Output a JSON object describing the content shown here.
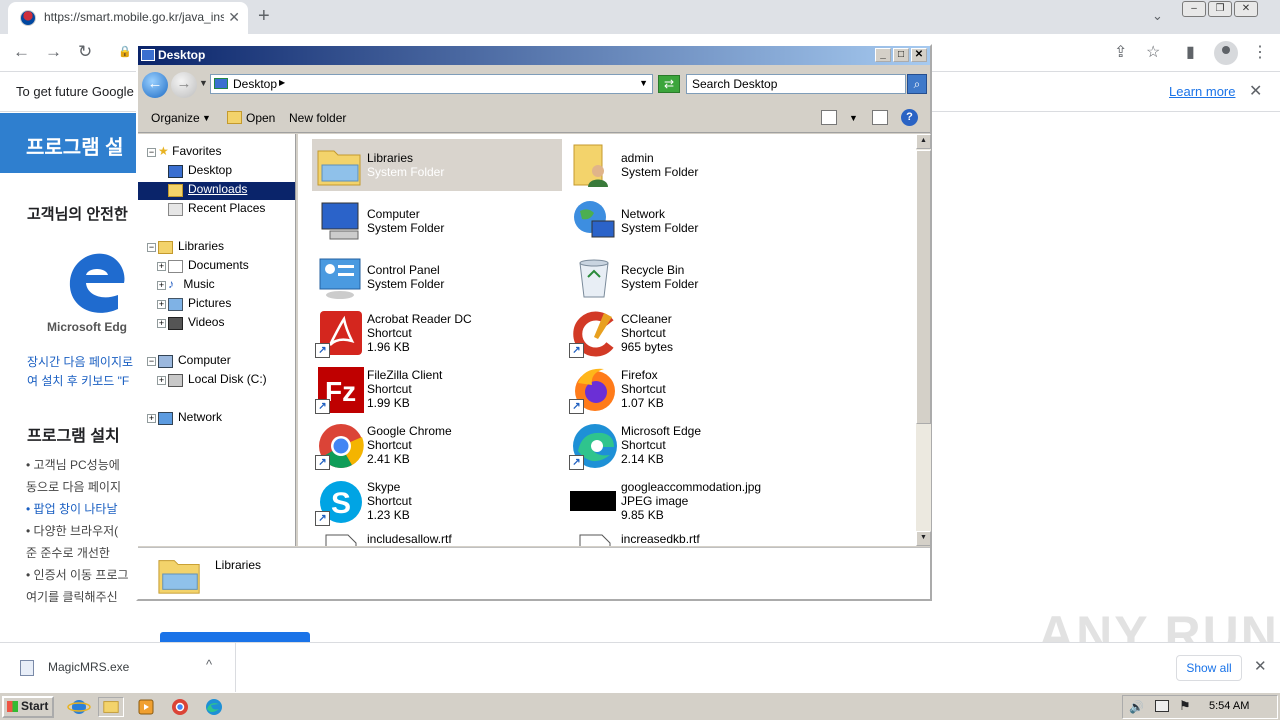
{
  "browser": {
    "tab_title": "https://smart.mobile.go.kr/java_inst",
    "tab_close": "✕",
    "new_tab": "+",
    "nav": {
      "back": "←",
      "forward": "→",
      "reload": "↻",
      "lock": "🔒"
    },
    "toolbar_icons": {
      "share": "⇪",
      "star": "☆",
      "sidebar": "▮",
      "menu": "⋮"
    },
    "win_buttons": {
      "minimize": "–",
      "restore": "❐",
      "close": "✕"
    },
    "infobar": {
      "text": "To get future Google",
      "learn_more": "Learn more",
      "close": "✕"
    }
  },
  "page": {
    "banner": "프로그램 설",
    "line1": "고객님의 안전한",
    "edge_caption": "Microsoft Edg",
    "link1": "장시간 다음 페이지로",
    "link2": "여 설치 후 키보드 \"F",
    "section_title": "프로그램 설치 ",
    "bullets": [
      "• 고객님 PC성능에",
      "  동으로 다음 페이지",
      "• 팝업 창이 나타날",
      "• 다양한 브라우저(",
      "  준 준수로 개선한",
      "• 인증서 이동 프로그",
      "  여기를 클릭해주신"
    ]
  },
  "explorer": {
    "title": "Desktop",
    "title_buttons": {
      "minimize": "_",
      "maximize": "□",
      "close": "✕"
    },
    "address": "Desktop",
    "search_placeholder": "Search Desktop",
    "toolbar": {
      "organize": "Organize",
      "open": "Open",
      "new_folder": "New folder",
      "help": "?"
    },
    "nav_tree": {
      "favorites": "Favorites",
      "desktop": "Desktop",
      "downloads": "Downloads",
      "recent": "Recent Places",
      "libraries": "Libraries",
      "documents": "Documents",
      "music": "Music",
      "pictures": "Pictures",
      "videos": "Videos",
      "computer": "Computer",
      "local_disk": "Local Disk (C:)",
      "network": "Network"
    },
    "files": [
      {
        "name": "Libraries",
        "type": "System Folder",
        "size": "",
        "icon": "libraries-folder-icon"
      },
      {
        "name": "admin",
        "type": "System Folder",
        "size": "",
        "icon": "user-folder-icon"
      },
      {
        "name": "Computer",
        "type": "System Folder",
        "size": "",
        "icon": "computer-icon"
      },
      {
        "name": "Network",
        "type": "System Folder",
        "size": "",
        "icon": "network-icon"
      },
      {
        "name": "Control Panel",
        "type": "System Folder",
        "size": "",
        "icon": "control-panel-icon"
      },
      {
        "name": "Recycle Bin",
        "type": "System Folder",
        "size": "",
        "icon": "recycle-bin-icon"
      },
      {
        "name": "Acrobat Reader DC",
        "type": "Shortcut",
        "size": "1.96 KB",
        "icon": "acrobat-icon"
      },
      {
        "name": "CCleaner",
        "type": "Shortcut",
        "size": "965 bytes",
        "icon": "ccleaner-icon"
      },
      {
        "name": "FileZilla Client",
        "type": "Shortcut",
        "size": "1.99 KB",
        "icon": "filezilla-icon"
      },
      {
        "name": "Firefox",
        "type": "Shortcut",
        "size": "1.07 KB",
        "icon": "firefox-icon"
      },
      {
        "name": "Google Chrome",
        "type": "Shortcut",
        "size": "2.41 KB",
        "icon": "chrome-icon"
      },
      {
        "name": "Microsoft Edge",
        "type": "Shortcut",
        "size": "2.14 KB",
        "icon": "edge-icon"
      },
      {
        "name": "Skype",
        "type": "Shortcut",
        "size": "1.23 KB",
        "icon": "skype-icon"
      },
      {
        "name": "googleaccommodation.jpg",
        "type": "JPEG image",
        "size": "9.85 KB",
        "icon": "jpeg-thumbnail-icon"
      },
      {
        "name": "includesallow.rtf",
        "type": "",
        "size": "",
        "icon": "rtf-document-icon"
      },
      {
        "name": "increasedkb.rtf",
        "type": "",
        "size": "",
        "icon": "rtf-document-icon"
      }
    ],
    "details_name": "Libraries"
  },
  "download_shelf": {
    "file": "MagicMRS.exe",
    "chevron": "^",
    "show_all": "Show all",
    "close": "✕"
  },
  "taskbar": {
    "start": "Start",
    "clock": "5:54 AM"
  },
  "watermark": "ANY RUN",
  "colors": {
    "title_bar_start": "#0a246a",
    "title_bar_end": "#a6caf0",
    "selection": "#0a246a",
    "link_blue": "#1a73e8",
    "classic_face": "#d4d0c8"
  }
}
